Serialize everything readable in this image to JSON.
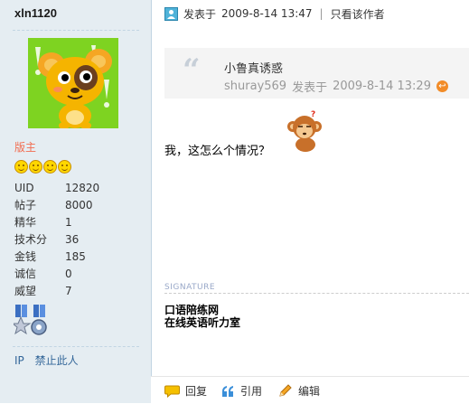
{
  "author": {
    "username": "xln1120",
    "role": "版主",
    "stats": [
      {
        "label": "UID",
        "value": "12820"
      },
      {
        "label": "帖子",
        "value": "8000"
      },
      {
        "label": "精华",
        "value": "1"
      },
      {
        "label": "技术分",
        "value": "36"
      },
      {
        "label": "金钱",
        "value": "185"
      },
      {
        "label": "诚信",
        "value": "0"
      },
      {
        "label": "威望",
        "value": "7"
      }
    ],
    "links": {
      "ip": "IP",
      "ban": "禁止此人"
    }
  },
  "post": {
    "posted_prefix": "发表于",
    "posted_time": "2009-8-14 13:47",
    "view_author_only": "只看该作者",
    "quote": {
      "title": "小鲁真诱惑",
      "author": "shuray569",
      "posted_prefix": "发表于",
      "time": "2009-8-14 13:29"
    },
    "message": "我，这怎么个情况？",
    "signature_label": "SIGNATURE",
    "signature_lines": [
      "口语陪练网",
      "在线英语听力室"
    ]
  },
  "actions": {
    "reply": "回复",
    "quote": "引用",
    "edit": "编辑"
  }
}
